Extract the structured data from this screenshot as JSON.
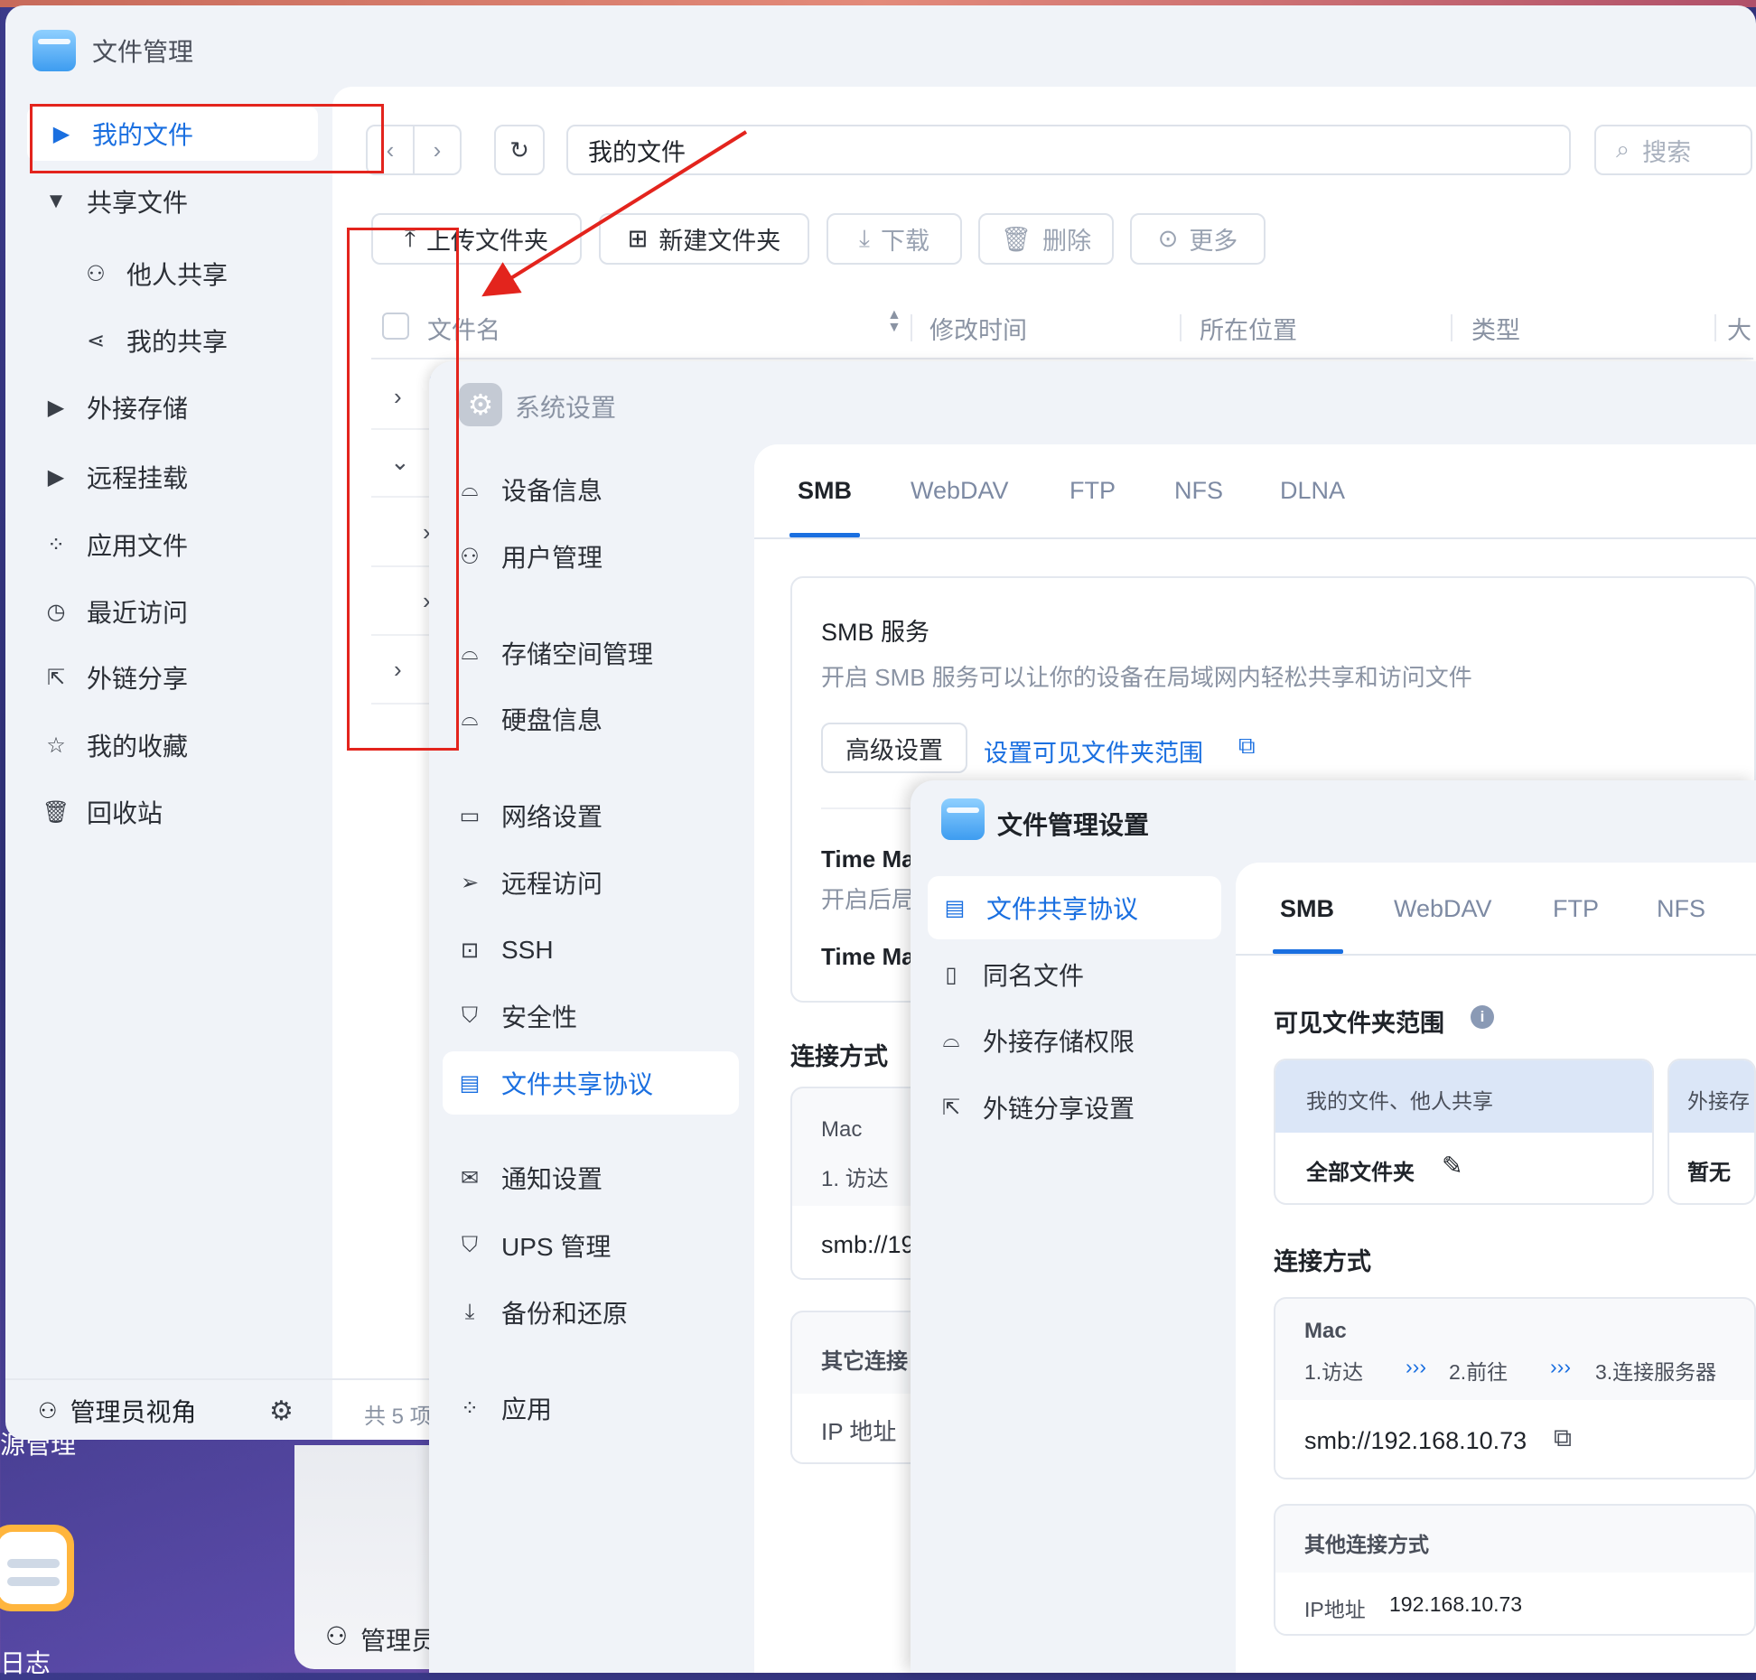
{
  "app": {
    "title": "文件管理"
  },
  "sidebar": {
    "items": [
      {
        "label": "我的文件",
        "icon": "caret-right-icon"
      },
      {
        "label": "共享文件",
        "icon": "caret-down-icon"
      },
      {
        "label": "他人共享",
        "icon": "user-icon"
      },
      {
        "label": "我的共享",
        "icon": "share-icon"
      },
      {
        "label": "外接存储",
        "icon": "caret-right-icon"
      },
      {
        "label": "远程挂载",
        "icon": "caret-right-icon"
      },
      {
        "label": "应用文件",
        "icon": "apps-icon"
      },
      {
        "label": "最近访问",
        "icon": "clock-icon"
      },
      {
        "label": "外链分享",
        "icon": "external-share-icon"
      },
      {
        "label": "我的收藏",
        "icon": "star-icon"
      },
      {
        "label": "回收站",
        "icon": "trash-icon"
      }
    ],
    "footer": {
      "label": "管理员视角"
    }
  },
  "toolbar": {
    "path": "我的文件",
    "search_placeholder": "搜索",
    "upload": "上传文件夹",
    "new_folder": "新建文件夹",
    "download": "下载",
    "delete": "删除",
    "more": "更多"
  },
  "table": {
    "columns": [
      "文件名",
      "修改时间",
      "所在位置",
      "类型",
      "大"
    ],
    "count": "共 5 项"
  },
  "desktop": {
    "label1": "源管理",
    "label2": "日志",
    "label3": "管理员"
  },
  "system_settings": {
    "title": "系统设置",
    "menu": [
      {
        "label": "设备信息",
        "icon": "drive-icon"
      },
      {
        "label": "用户管理",
        "icon": "user-gear-icon"
      },
      {
        "label": "存储空间管理",
        "icon": "storage-icon"
      },
      {
        "label": "硬盘信息",
        "icon": "disk-icon"
      },
      {
        "label": "网络设置",
        "icon": "network-icon"
      },
      {
        "label": "远程访问",
        "icon": "send-icon"
      },
      {
        "label": "SSH",
        "icon": "code-icon"
      },
      {
        "label": "安全性",
        "icon": "shield-check-icon"
      },
      {
        "label": "文件共享协议",
        "icon": "document-icon"
      },
      {
        "label": "通知设置",
        "icon": "mail-icon"
      },
      {
        "label": "UPS 管理",
        "icon": "shield-icon"
      },
      {
        "label": "备份和还原",
        "icon": "download-icon"
      },
      {
        "label": "应用",
        "icon": "apps-icon"
      }
    ],
    "tabs": [
      "SMB",
      "WebDAV",
      "FTP",
      "NFS",
      "DLNA"
    ],
    "smb_title": "SMB 服务",
    "smb_desc": "开启 SMB 服务可以让你的设备在局域网内轻松共享和访问文件",
    "advanced": "高级设置",
    "folder_scope_link": "设置可见文件夹范围",
    "tm1": "Time Ma",
    "tm_desc": "开启后局",
    "tm2": "Time Ma",
    "conn_title": "连接方式",
    "mac": "Mac",
    "mac_step": "1. 访达",
    "smb_partial": "smb://19",
    "other_partial": "其它连接",
    "ip_partial": "IP 地址"
  },
  "fm_settings": {
    "title": "文件管理设置",
    "menu": [
      {
        "label": "文件共享协议",
        "icon": "document-icon"
      },
      {
        "label": "同名文件",
        "icon": "file-icon"
      },
      {
        "label": "外接存储权限",
        "icon": "drive-icon"
      },
      {
        "label": "外链分享设置",
        "icon": "external-share-icon"
      }
    ],
    "tabs": [
      "SMB",
      "WebDAV",
      "FTP",
      "NFS"
    ],
    "scope_title": "可见文件夹范围",
    "scope_cards": [
      {
        "header": "我的文件、他人共享",
        "value": "全部文件夹"
      },
      {
        "header": "外接存",
        "value": "暂无"
      }
    ],
    "conn_title": "连接方式",
    "mac": "Mac",
    "steps": [
      "1.访达",
      "2.前往",
      "3.连接服务器"
    ],
    "step_sep": "›››",
    "smb_url": "smb://192.168.10.73",
    "other_title": "其他连接方式",
    "ip_label": "IP地址",
    "ip_value": "192.168.10.73"
  },
  "colors": {
    "accent": "#1a6fe0",
    "annotation": "#e3241d"
  }
}
